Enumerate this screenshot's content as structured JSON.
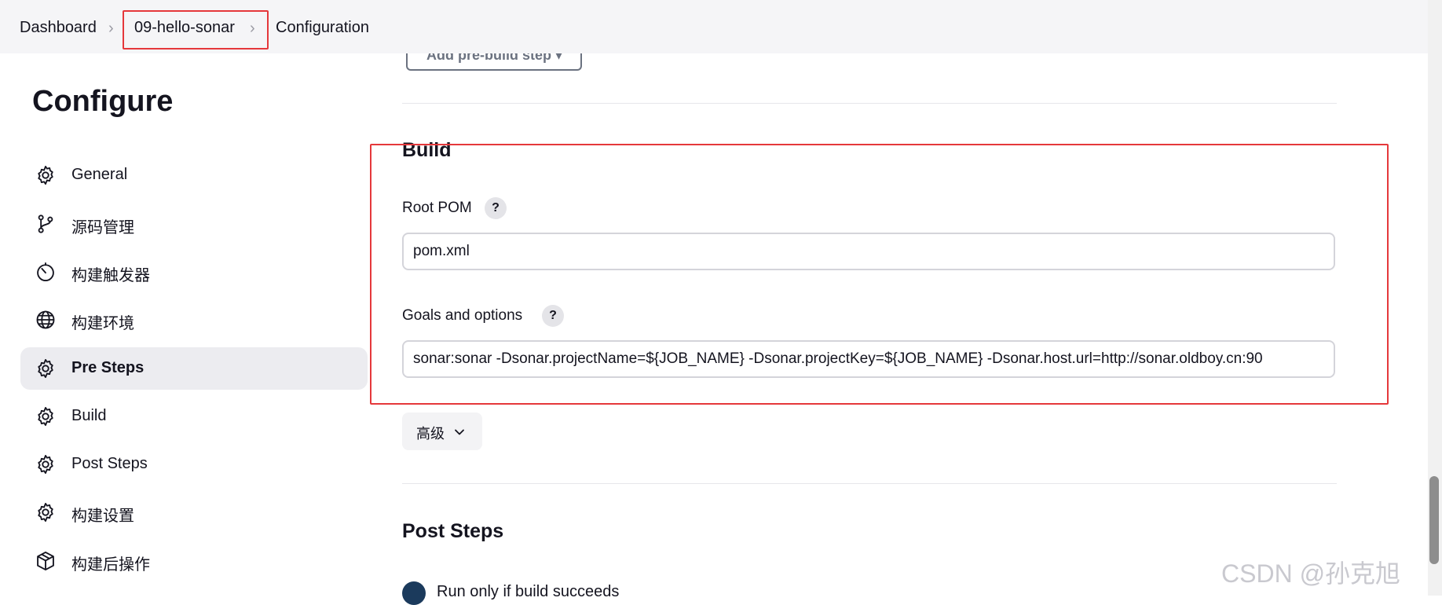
{
  "breadcrumb": {
    "items": [
      "Dashboard",
      "09-hello-sonar",
      "Configuration"
    ]
  },
  "prebuild": {
    "label": "Add pre-build step ▾"
  },
  "sidebar": {
    "title": "Configure",
    "items": [
      {
        "label": "General",
        "icon": "gear-icon"
      },
      {
        "label": "源码管理",
        "icon": "git-branch-icon"
      },
      {
        "label": "构建触发器",
        "icon": "timer-icon"
      },
      {
        "label": "构建环境",
        "icon": "globe-icon"
      },
      {
        "label": "Pre Steps",
        "icon": "gear-icon",
        "active": true
      },
      {
        "label": "Build",
        "icon": "gear-icon"
      },
      {
        "label": "Post Steps",
        "icon": "gear-icon"
      },
      {
        "label": "构建设置",
        "icon": "gear-icon"
      },
      {
        "label": "构建后操作",
        "icon": "package-icon"
      }
    ]
  },
  "build": {
    "title": "Build",
    "root_pom_label": "Root POM",
    "root_pom_value": "pom.xml",
    "goals_label": "Goals and options",
    "goals_value": "sonar:sonar -Dsonar.projectName=${JOB_NAME} -Dsonar.projectKey=${JOB_NAME} -Dsonar.host.url=http://sonar.oldboy.cn:90",
    "help_glyph": "?",
    "advanced_label": "高级"
  },
  "post_steps": {
    "title": "Post Steps",
    "radio_label": "Run only if build succeeds"
  },
  "watermark": "CSDN @孙克旭",
  "colors": {
    "highlight": "#e5383b",
    "active_bg": "#ececf0",
    "radio": "#1b3a5c"
  }
}
